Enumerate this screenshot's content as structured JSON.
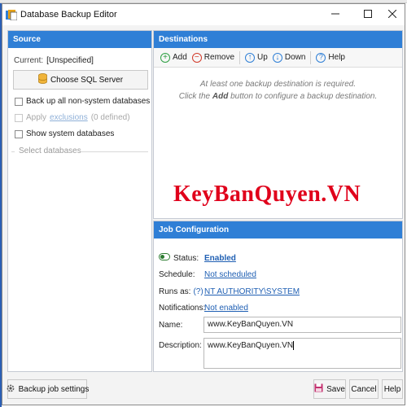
{
  "window": {
    "title": "Database Backup Editor"
  },
  "source": {
    "header": "Source",
    "current_label": "Current:",
    "current_value": "[Unspecified]",
    "choose_label": "Choose SQL Server",
    "backup_all_label": "Back up all non-system databases",
    "apply_label": "Apply",
    "exclusions_link": "exclusions",
    "exclusions_count": "(0 defined)",
    "show_system_label": "Show system databases",
    "select_databases_label": "Select databases"
  },
  "destinations": {
    "header": "Destinations",
    "toolbar": {
      "add": "Add",
      "remove": "Remove",
      "up": "Up",
      "down": "Down",
      "help": "Help"
    },
    "empty_line1": "At least one backup destination is required.",
    "empty_line2_pre": "Click the",
    "empty_line2_bold": "Add",
    "empty_line2_post": "button to configure a backup destination."
  },
  "watermark": "KeyBanQuyen.VN",
  "job": {
    "header": "Job Configuration",
    "status_label": "Status:",
    "status_value": "Enabled",
    "schedule_label": "Schedule:",
    "schedule_value": "Not scheduled",
    "runs_as_label": "Runs as:",
    "runs_as_help": "(?)",
    "runs_as_value": "NT AUTHORITY\\SYSTEM",
    "notifications_label": "Notifications:",
    "notifications_value": "Not enabled",
    "name_label": "Name:",
    "name_value": "www.KeyBanQuyen.VN",
    "description_label": "Description:",
    "description_value": "www.KeyBanQuyen.VN"
  },
  "footer": {
    "settings_label": "Backup job settings",
    "save": "Save",
    "cancel": "Cancel",
    "help": "Help"
  },
  "colors": {
    "accent": "#2f7fd6",
    "link": "#1f5fb3",
    "add": "#2ea043",
    "remove": "#d23a2a",
    "watermark": "#e0001b"
  },
  "icons": {
    "app": "app-icon",
    "minimize": "minimize-icon",
    "maximize": "maximize-icon",
    "close": "close-icon",
    "server": "database-server-icon",
    "add": "add-icon",
    "remove": "remove-icon",
    "up": "arrow-up-icon",
    "down": "arrow-down-icon",
    "help": "help-icon",
    "status": "toggle-icon",
    "settings": "gear-icon",
    "save": "save-icon"
  }
}
